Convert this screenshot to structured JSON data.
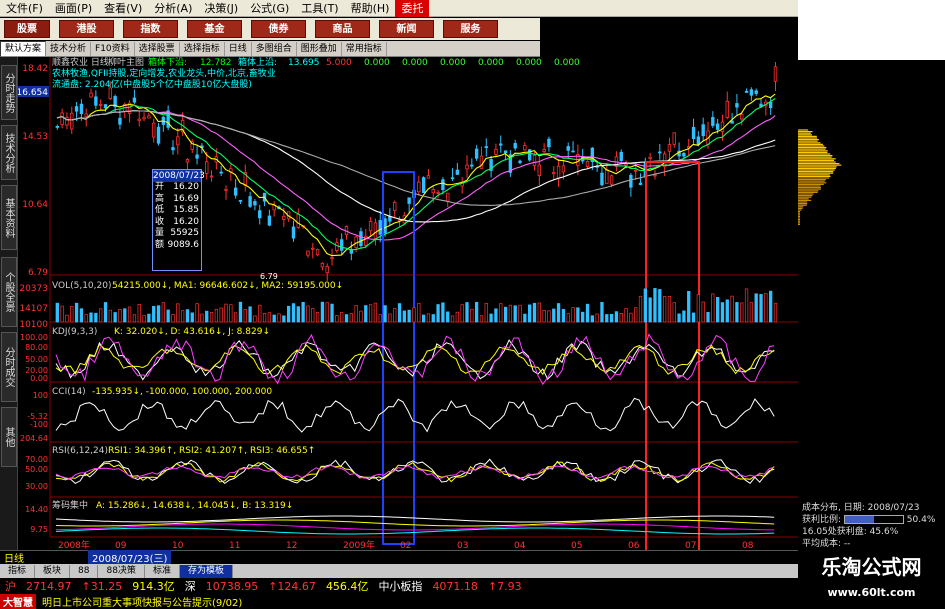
{
  "menu": [
    "文件(F)",
    "画面(P)",
    "查看(V)",
    "分析(A)",
    "决策(J)",
    "公式(G)",
    "工具(T)",
    "帮助(H)",
    "委托"
  ],
  "func_buttons": [
    "股票",
    "港股",
    "指数",
    "基金",
    "债券",
    "商品",
    "新闻",
    "服务"
  ],
  "toolbar": [
    "默认方案",
    "技术分析",
    "F10资料",
    "选择股票",
    "选择指标",
    "日线",
    "多图组合",
    "图形叠加",
    "常用指标"
  ],
  "left_tabs": [
    "分时走势",
    "技术分析",
    "基本资料",
    "个股全景",
    "分时成交",
    "其他"
  ],
  "chart": {
    "header_name": "顺鑫农业 日线",
    "header_main": "柳叶主图",
    "header_resist_label": "箱体下沿:",
    "header_resist_val": "12.782",
    "header_upper_label": "箱体上沿:",
    "header_upper_val": "13.695",
    "header_vals": [
      "5.000",
      "0.000",
      "0.000",
      "0.000",
      "0.000",
      "0.000",
      "0.000"
    ],
    "concepts": "农林牧渔,QFII持股,定向增发,农业龙头,中价,北京,畜牧业",
    "circulation": "流通盘: 2.204亿(中盘股5个亿中盘股10亿大盘股)",
    "price_ticks": [
      "18.42",
      "16.654",
      "14.53",
      "10.64",
      "6.79"
    ],
    "low_mark": "6.79",
    "vol_label": "VOL(5,10,20)",
    "vol_vals": "54215.000↓, MA1: 96646.602↓, MA2: 59195.000↓",
    "vol_ticks": [
      "20373",
      "14107",
      "10100"
    ],
    "kdj_label": "KDJ(9,3,3)",
    "kdj_vals": "K: 32.020↓, D: 43.616↓, J: 8.829↓",
    "kdj_ticks": [
      "100.00",
      "80.00",
      "50.00",
      "20.00",
      "0.00"
    ],
    "cci_label": "CCI(14)",
    "cci_vals": "-135.935↓, -100.000, 100.000, 200.000",
    "cci_ticks": [
      "100",
      "-5.32",
      "-100",
      "204.64"
    ],
    "rsi_label": "RSI(6,12,24)",
    "rsi_vals": "RSI1: 34.396↑, RSI2: 41.207↑, RSI3: 46.655↑",
    "rsi_ticks": [
      "70.00",
      "50.00",
      "30.00"
    ],
    "chip_label": "筹码集中",
    "chip_vals": "A: 15.286↓, 14.638↓, 14.045↓, B: 13.319↓",
    "chip_ticks": [
      "14.40",
      "9.75"
    ],
    "date_ticks": [
      "2008年",
      "09",
      "10",
      "11",
      "12",
      "2009年",
      "02",
      "03",
      "04",
      "05",
      "06",
      "07",
      "08"
    ],
    "colors": {
      "up": "#ff3030",
      "down": "#30c0ff",
      "ma1": "#ffffff",
      "ma2": "#ffff00",
      "ma3": "#ff60ff",
      "ma4": "#00ff60",
      "blue_box": "#2040ff",
      "red_box": "#ff2020"
    }
  },
  "infobox": {
    "date": "2008/07/23",
    "rows": [
      [
        "开",
        "16.20"
      ],
      [
        "高",
        "16.69"
      ],
      [
        "低",
        "15.85"
      ],
      [
        "收",
        "16.20"
      ],
      [
        "量",
        "55925"
      ],
      [
        "额",
        "9089.6"
      ]
    ]
  },
  "right_panel": {
    "title": "成本分布, 日期: 2008/07/23",
    "profit_label": "获利比例:",
    "profit_val": "50.4%",
    "profit_frac": 0.504,
    "cost_line": "16.05处获利盘: 45.6%",
    "avg_line": "平均成本: --"
  },
  "timeline": {
    "label": "日线",
    "date": "2008/07/23(三)"
  },
  "tabs": [
    "指标",
    "板块",
    "88",
    "88决策",
    "标准",
    "存为模板"
  ],
  "index_row": {
    "hu_label": "沪",
    "hu_val": "2714.97",
    "hu_chg": "↑31.25",
    "hu_amt": "914.3亿",
    "sz_label": "深",
    "sz_val": "10738.95",
    "sz_chg": "↑124.67",
    "sz_amt": "456.4亿",
    "zxb_label": "中小板指",
    "zxb_val": "4071.18",
    "zxb_chg": "↑7.93"
  },
  "status": {
    "logo": "大智慧",
    "text": "明日上市公司重大事项快报与公告提示(9/02)"
  },
  "watermark": {
    "title": "乐淘公式网",
    "url": "www.60lt.com"
  }
}
